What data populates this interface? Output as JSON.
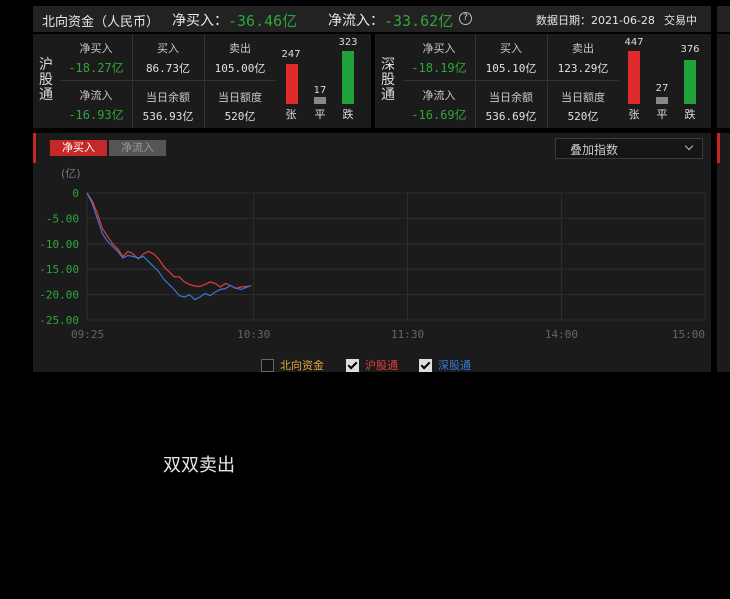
{
  "header": {
    "title": "北向资金（人民币）",
    "net_buy_label": "净买入：",
    "net_buy_value": "-36.46亿",
    "net_inflow_label": "净流入：",
    "net_inflow_value": "-33.62亿",
    "help_icon": "question-circle-icon",
    "date_text": "数据日期：2021-06-28",
    "status": "交易中"
  },
  "hgt": {
    "name": "沪股通",
    "net_buy_label": "净买入",
    "net_buy_value": "-18.27亿",
    "buy_label": "买入",
    "buy_value": "86.73亿",
    "sell_label": "卖出",
    "sell_value": "105.00亿",
    "net_inflow_label": "净流入",
    "net_inflow_value": "-16.93亿",
    "balance_label": "当日余额",
    "balance_value": "536.93亿",
    "quota_label": "当日额度",
    "quota_value": "520亿",
    "up_count": "247",
    "flat_count": "17",
    "down_count": "323",
    "up_label": "张",
    "flat_label": "平",
    "down_label": "跌"
  },
  "sgt": {
    "name": "深股通",
    "net_buy_label": "净买入",
    "net_buy_value": "-18.19亿",
    "buy_label": "买入",
    "buy_value": "105.10亿",
    "sell_label": "卖出",
    "sell_value": "123.29亿",
    "net_inflow_label": "净流入",
    "net_inflow_value": "-16.69亿",
    "balance_label": "当日余额",
    "balance_value": "536.69亿",
    "quota_label": "当日额度",
    "quota_value": "520亿",
    "up_count": "447",
    "flat_count": "27",
    "down_count": "376",
    "up_label": "张",
    "flat_label": "平",
    "down_label": "跌"
  },
  "tabs": {
    "net_buy": "净买入",
    "net_inflow": "净流入"
  },
  "overlay_select": {
    "label": "叠加指数"
  },
  "legend": {
    "north": {
      "label": "北向资金",
      "checked": false
    },
    "hgt": {
      "label": "沪股通",
      "checked": true
    },
    "sgt": {
      "label": "深股通",
      "checked": true
    }
  },
  "caption": "双双卖出",
  "colors": {
    "up": "#e02a2a",
    "down": "#1fa33a",
    "hgt_line": "#e83a3a",
    "sgt_line": "#3a78d8",
    "north_label": "#e0a33a",
    "accent_tab": "#c62828"
  },
  "chart_data": {
    "type": "line",
    "ylabel": "(亿)",
    "ylim": [
      -25,
      0
    ],
    "yticks": [
      "0",
      "-5.00",
      "-10.00",
      "-15.00",
      "-20.00",
      "-25.00"
    ],
    "xticks": [
      "09:25",
      "10:30",
      "11:30",
      "14:00",
      "15:00"
    ],
    "xlim_minutes": [
      0,
      241
    ],
    "series": [
      {
        "name": "沪股通",
        "color": "#e83a3a",
        "x": [
          0,
          2,
          4,
          6,
          8,
          10,
          12,
          14,
          16,
          18,
          20,
          22,
          24,
          26,
          28,
          30,
          32,
          34,
          36,
          38,
          40,
          42,
          44,
          46,
          48,
          50,
          52,
          54,
          56,
          58,
          60,
          62,
          64
        ],
        "y": [
          0,
          -1.5,
          -4,
          -7,
          -8.5,
          -10,
          -11,
          -12.5,
          -11.5,
          -12,
          -13,
          -12,
          -11.5,
          -12,
          -13,
          -14.5,
          -15.5,
          -16.5,
          -16.5,
          -17.5,
          -18,
          -18.3,
          -18.4,
          -18,
          -17.5,
          -17.8,
          -18.5,
          -17.8,
          -18.2,
          -18.8,
          -18.5,
          -18.4,
          -18.3
        ]
      },
      {
        "name": "深股通",
        "color": "#3a78d8",
        "x": [
          0,
          2,
          4,
          6,
          8,
          10,
          12,
          14,
          16,
          18,
          20,
          22,
          24,
          26,
          28,
          30,
          32,
          34,
          36,
          38,
          40,
          42,
          44,
          46,
          48,
          50,
          52,
          54,
          56,
          58,
          60,
          62,
          64
        ],
        "y": [
          0,
          -2,
          -5,
          -8,
          -9.5,
          -10.5,
          -11.5,
          -12.8,
          -12.3,
          -12.5,
          -12.8,
          -12.5,
          -13.5,
          -14.5,
          -15.5,
          -17,
          -18,
          -19,
          -20.2,
          -20.5,
          -20,
          -21,
          -20.5,
          -19.8,
          -20.2,
          -19.5,
          -19,
          -18.8,
          -18.2,
          -18.7,
          -19,
          -18.6,
          -18.2
        ]
      }
    ]
  }
}
